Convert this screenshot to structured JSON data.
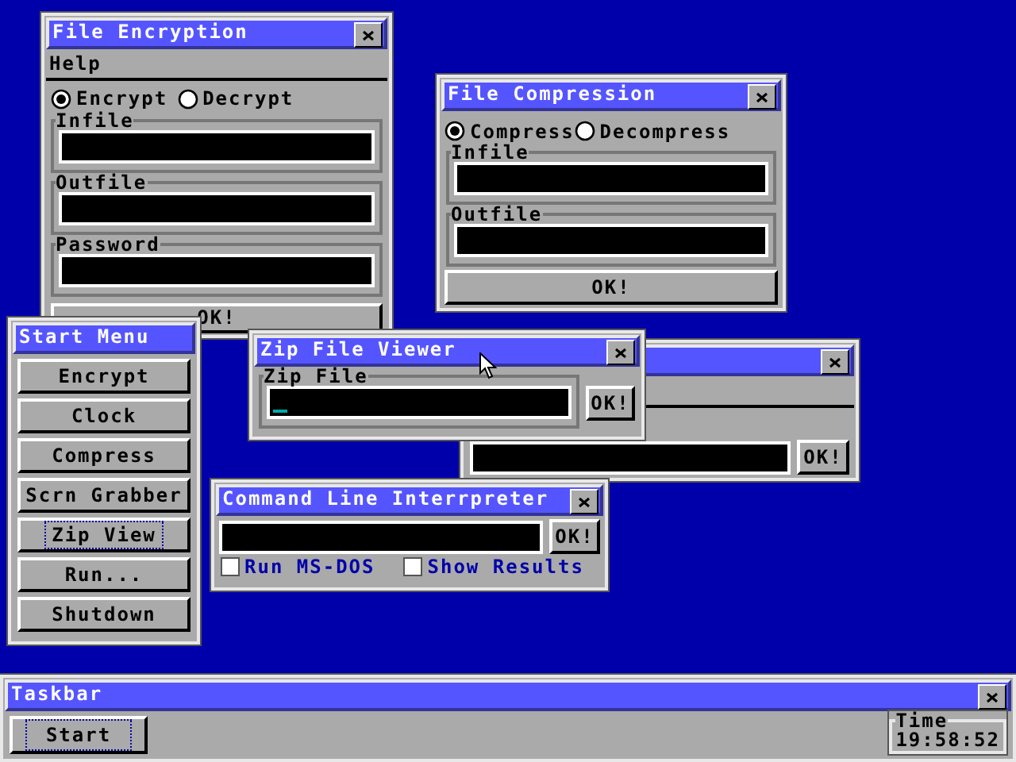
{
  "file_encryption": {
    "title": "File Encryption",
    "menu": [
      "Help"
    ],
    "mode_options": [
      {
        "label": "Encrypt",
        "selected": true
      },
      {
        "label": "Decrypt",
        "selected": false
      }
    ],
    "fields": [
      {
        "label": "Infile"
      },
      {
        "label": "Outfile"
      },
      {
        "label": "Password"
      }
    ],
    "ok_button": "OK!"
  },
  "file_compression": {
    "title": "File Compression",
    "mode_options": [
      {
        "label": "Compress",
        "selected": true
      },
      {
        "label": "Decompress",
        "selected": false
      }
    ],
    "fields": [
      {
        "label": "Infile"
      },
      {
        "label": "Outfile"
      }
    ],
    "ok_button": "OK!"
  },
  "background_window": {
    "ok_button": "OK!"
  },
  "start_menu": {
    "title": "Start Menu",
    "items": [
      {
        "label": "Encrypt",
        "focused": false
      },
      {
        "label": "Clock",
        "focused": false
      },
      {
        "label": "Compress",
        "focused": false
      },
      {
        "label": "Scrn Grabber",
        "focused": false
      },
      {
        "label": "Zip View",
        "focused": true
      },
      {
        "label": "Run...",
        "focused": false
      },
      {
        "label": "Shutdown",
        "focused": false
      }
    ]
  },
  "zip_file_viewer": {
    "title": "Zip File Viewer",
    "field": {
      "label": "Zip File",
      "cursor": true
    },
    "ok_button": "OK!"
  },
  "command_line_interpreter": {
    "title": "Command Line Interrpreter",
    "ok_button": "OK!",
    "options": [
      {
        "label": "Run MS-DOS",
        "checked": false
      },
      {
        "label": "Show Results",
        "checked": false
      }
    ]
  },
  "taskbar": {
    "title": "Taskbar",
    "start_button": {
      "label": "Start",
      "focused": true
    },
    "clock": {
      "label": "Time",
      "value": "19:58:52"
    }
  }
}
